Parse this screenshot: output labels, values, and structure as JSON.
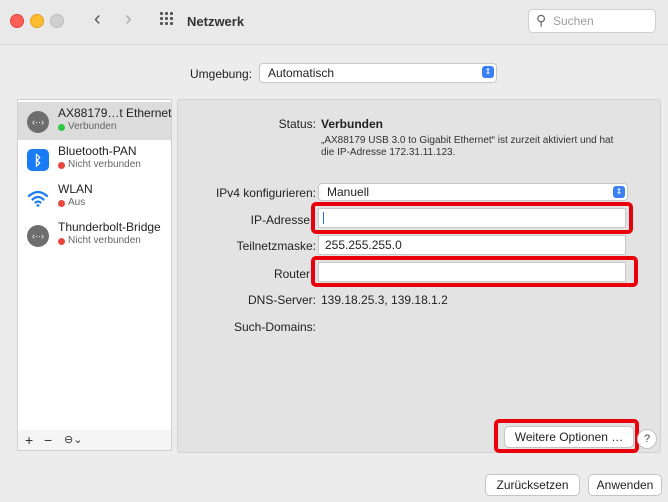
{
  "window": {
    "title": "Netzwerk",
    "search_placeholder": "Suchen"
  },
  "environment": {
    "label": "Umgebung:",
    "value": "Automatisch"
  },
  "sidebar": {
    "items": [
      {
        "name": "AX88179…t Ethernet",
        "status": "Verbunden",
        "status_color": "#2ec840",
        "icon": "ethernet-icon"
      },
      {
        "name": "Bluetooth-PAN",
        "status": "Nicht verbunden",
        "status_color": "#e8453c",
        "icon": "bluetooth-icon"
      },
      {
        "name": "WLAN",
        "status": "Aus",
        "status_color": "#e8453c",
        "icon": "wifi-icon"
      },
      {
        "name": "Thunderbolt-Bridge",
        "status": "Nicht verbunden",
        "status_color": "#e8453c",
        "icon": "ethernet-icon"
      }
    ],
    "footer": {
      "add": "+",
      "remove": "−",
      "action": "⊖⌄"
    }
  },
  "details": {
    "status_label": "Status:",
    "status_value": "Verbunden",
    "status_desc": "„AX88179 USB 3.0 to Gigabit Ethernet“ ist zurzeit aktiviert und hat die IP-Adresse 172.31.11.123.",
    "ipv4_label": "IPv4 konfigurieren:",
    "ipv4_value": "Manuell",
    "ip_label": "IP-Adresse",
    "ip_value": "",
    "subnet_label": "Teilnetzmaske:",
    "subnet_value": "255.255.255.0",
    "router_label": "Router",
    "router_value": "",
    "dns_label": "DNS-Server:",
    "dns_value": "139.18.25.3, 139.18.1.2",
    "domains_label": "Such-Domains:"
  },
  "buttons": {
    "more_options": "Weitere Optionen …",
    "help": "?",
    "revert": "Zurücksetzen",
    "apply": "Anwenden"
  },
  "colors": {
    "highlight": "#e8000c",
    "accent": "#3a80f2"
  }
}
